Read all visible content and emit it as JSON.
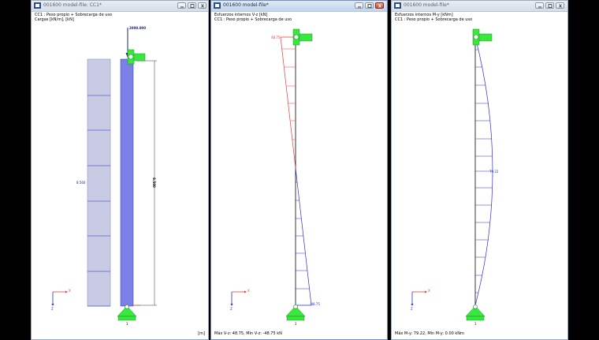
{
  "windows": [
    {
      "title": "001600 model-file: CC1*",
      "header_lines": [
        "CC1 : Peso propio + Sobrecarga de uso",
        "Cargas [kN/m], [kN]"
      ],
      "point_load": "2000.000",
      "dist_load": "8.560",
      "dim_label": "6.500",
      "unit": "[m]",
      "axis_x": "X",
      "axis_z": "Z",
      "support_label": "1"
    },
    {
      "title": "001600 model-file*",
      "header_lines": [
        "Esfuerzos internos V-z [kN]",
        "CC1 : Peso propio + Sobrecarga de uso"
      ],
      "top_value": "48.75",
      "bottom_value": "-48.75",
      "status": "Máx V-z: 48.75, Mín V-z: -48.75 kN",
      "axis_x": "X",
      "axis_z": "Z",
      "support_label": "1"
    },
    {
      "title": "001600 model-file*",
      "header_lines": [
        "Esfuerzos internos M-y [kNm]",
        "CC1 : Peso propio + Sobrecarga de uso"
      ],
      "mid_value": "79.22",
      "status": "Máx M-y: 79.22, Mín M-y: 0.00 kNm",
      "axis_x": "X",
      "axis_z": "Z",
      "support_label": "1"
    }
  ],
  "colors": {
    "load": "#c8cbe3",
    "member": "#7b80e6",
    "shear_pos": "#e33b3b",
    "diagram": "#2a2ed0",
    "support": "#39e83f"
  }
}
